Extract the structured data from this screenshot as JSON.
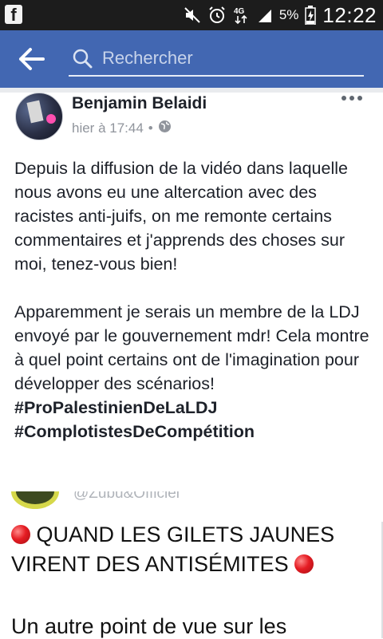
{
  "status_bar": {
    "app_icon": "facebook-icon",
    "network": "4G",
    "battery_percent": "5%",
    "time": "12:22"
  },
  "header": {
    "search_placeholder": "Rechercher",
    "color": "#4267b2"
  },
  "post": {
    "author": "Benjamin Belaidi",
    "timestamp": "hier à 17:44",
    "separator": "•",
    "audience_icon": "globe-icon",
    "paragraph1": "Depuis la diffusion de la vidéo dans laquelle nous avons eu une altercation avec des racistes anti-juifs, on me remonte certains commentaires et j'apprends des choses sur moi, tenez-vous bien!",
    "paragraph2": "Apparemment je serais un membre de la LDJ envoyé par le gouvernement mdr! Cela montre à quel point certains ont de l'imagination pour développer des scénarios!",
    "hashtags": [
      "#ProPalestinienDeLaLDJ",
      "#ComplotistesDeCompétition"
    ]
  },
  "shared": {
    "handle": "@Zubu&Officiel",
    "title_part1": "QUAND LES GILETS JAUNES VIRENT DES ANTISÉMITES",
    "subtitle": "Un autre point de vue sur les"
  }
}
